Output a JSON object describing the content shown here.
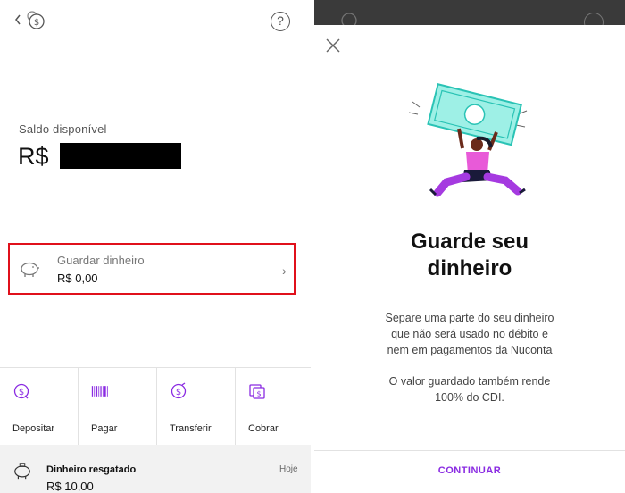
{
  "left": {
    "header": {
      "help_label": "?"
    },
    "balance": {
      "label": "Saldo disponível",
      "currency": "R$"
    },
    "save_card": {
      "title": "Guardar dinheiro",
      "amount": "R$ 0,00",
      "chevron": "›"
    },
    "actions": [
      {
        "label": "Depositar",
        "icon": "deposit-coin-icon"
      },
      {
        "label": "Pagar",
        "icon": "barcode-icon"
      },
      {
        "label": "Transferir",
        "icon": "transfer-coin-icon"
      },
      {
        "label": "Cobrar",
        "icon": "charge-icon"
      }
    ],
    "activity": {
      "title": "Dinheiro resgatado",
      "value": "R$ 10,00",
      "date": "Hoje",
      "icon": "piggy-bank-icon"
    }
  },
  "right": {
    "title_line1": "Guarde seu",
    "title_line2": "dinheiro",
    "body_line1": "Separe uma parte do seu dinheiro",
    "body_line2": "que não será usado no débito e",
    "body_line3": "nem em pagamentos da Nuconta",
    "body2_line1": "O valor guardado também rende",
    "body2_line2": "100% do CDI.",
    "continue_label": "CONTINUAR"
  },
  "colors": {
    "accent": "#8a2be2",
    "highlight_border": "#e0101b",
    "teal": "#2ac3b5"
  }
}
